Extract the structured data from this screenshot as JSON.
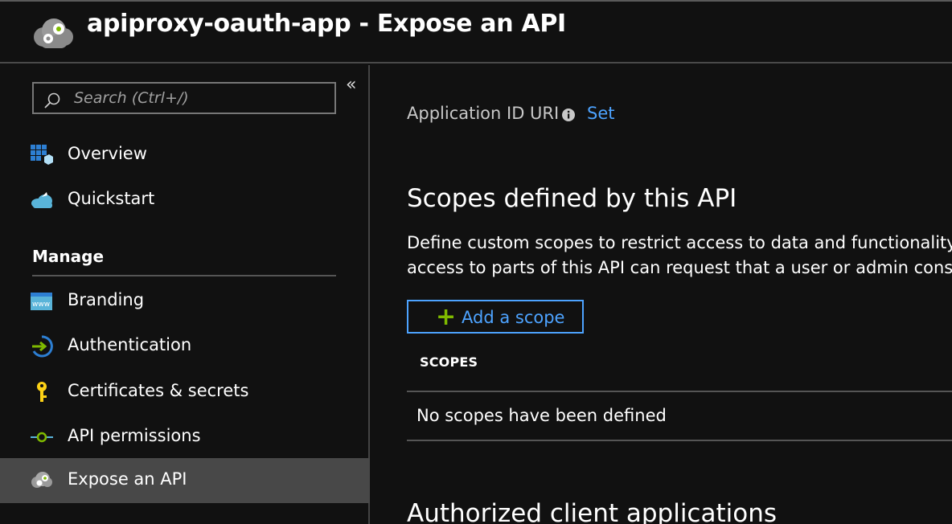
{
  "header": {
    "title": "apiproxy-oauth-app - Expose an API",
    "icon": "app-gears-cloud-icon"
  },
  "sidebar": {
    "search_placeholder": "Search (Ctrl+/)",
    "collapse_glyph": "«",
    "items_top": [
      {
        "label": "Overview",
        "icon": "overview-grid-icon"
      },
      {
        "label": "Quickstart",
        "icon": "quickstart-cloud-icon"
      }
    ],
    "manage_title": "Manage",
    "items_manage": [
      {
        "label": "Branding",
        "icon": "branding-www-icon"
      },
      {
        "label": "Authentication",
        "icon": "authentication-arrow-icon"
      },
      {
        "label": "Certificates & secrets",
        "icon": "key-icon"
      },
      {
        "label": "API permissions",
        "icon": "api-permissions-icon"
      },
      {
        "label": "Expose an API",
        "icon": "expose-api-gears-icon",
        "active": true
      }
    ]
  },
  "main": {
    "app_id_label": "Application ID URI",
    "set_link": "Set",
    "scopes_heading": "Scopes defined by this API",
    "scopes_desc_line1": "Define custom scopes to restrict access to data and functionality pro",
    "scopes_desc_line2": "access to parts of this API can request that a user or admin consent",
    "add_scope_label": "Add a scope",
    "table_header": "SCOPES",
    "empty_message": "No scopes have been defined",
    "authorized_heading": "Authorized client applications"
  },
  "colors": {
    "background": "#111111",
    "link": "#4da3ff",
    "plus": "#7fba00",
    "active_item": "#484848"
  }
}
